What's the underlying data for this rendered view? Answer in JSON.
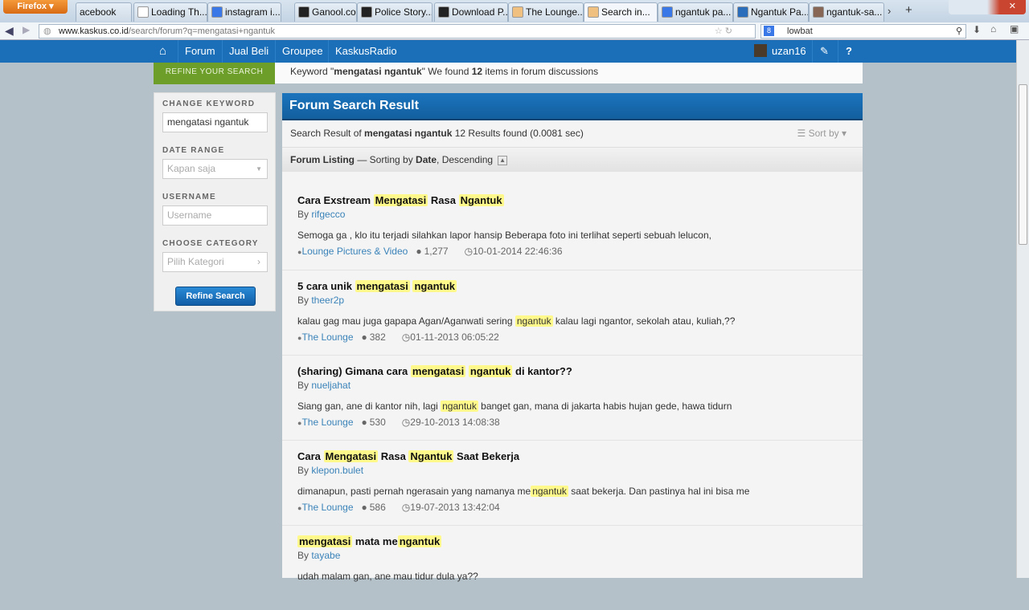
{
  "browser": {
    "menu": "Firefox",
    "tabs": [
      {
        "label": "acebook",
        "color": "#ffffff"
      },
      {
        "label": "Loading Th...",
        "color": "#ffffff"
      },
      {
        "label": "instagram i...",
        "color": "#3b78e7"
      },
      {
        "label": "Ganool.co...",
        "color": "#222222"
      },
      {
        "label": "Police Story...",
        "color": "#222222"
      },
      {
        "label": "Download P...",
        "color": "#222222"
      },
      {
        "label": "The Lounge...",
        "color": "#f0c080"
      },
      {
        "label": "Search in...",
        "color": "#f0c080"
      },
      {
        "label": "ngantuk pa...",
        "color": "#3b78e7"
      },
      {
        "label": "Ngantuk Pa...",
        "color": "#2a6ebb"
      },
      {
        "label": "ngantuk-sa...",
        "color": "#886655"
      }
    ],
    "url_host": "www.kaskus.co.id",
    "url_path": "/search/forum?q=mengatasi+ngantuk",
    "search_value": "lowbat"
  },
  "nav": {
    "items": [
      "Forum",
      "Jual Beli",
      "Groupee",
      "KaskusRadio"
    ],
    "username": "uzan16"
  },
  "refine": {
    "tab": "REFINE YOUR SEARCH",
    "kw_pre": "Keyword \"",
    "kw": "mengatasi ngantuk",
    "kw_mid": "\" We found ",
    "count": "12",
    "kw_post": " items in forum discussions"
  },
  "sidebar": {
    "change_keyword": "CHANGE KEYWORD",
    "keyword_value": "mengatasi ngantuk",
    "date_range": "DATE RANGE",
    "date_value": "Kapan saja",
    "username": "USERNAME",
    "username_placeholder": "Username",
    "category": "CHOOSE CATEGORY",
    "category_value": "Pilih Kategori",
    "button": "Refine Search"
  },
  "main": {
    "title": "Forum Search Result",
    "sr_pre": "Search Result of ",
    "sr_kw": "mengatasi ngantuk",
    "sr_post": " 12 Results found (0.0081 sec)",
    "sort": "Sort by",
    "listing": "Forum Listing",
    "listing_mid": " — Sorting by ",
    "listing_key": "Date",
    "listing_post": ", Descending"
  },
  "results": [
    {
      "title": [
        [
          "Cara Exstream ",
          0
        ],
        [
          "Mengatasi",
          1
        ],
        [
          " Rasa ",
          0
        ],
        [
          "Ngantuk",
          1
        ]
      ],
      "by": "rifgecco",
      "snippet": [
        [
          "Semoga ga , klo itu terjadi silahkan lapor hansip Beberapa foto ini terlihat seperti sebuah lelucon,",
          0
        ]
      ],
      "category": "Lounge Pictures & Video",
      "replies": "1,277",
      "date": "10-01-2014 22:46:36"
    },
    {
      "title": [
        [
          "5 cara unik ",
          0
        ],
        [
          "mengatasi",
          1
        ],
        [
          " ",
          0
        ],
        [
          "ngantuk",
          1
        ]
      ],
      "by": "theer2p",
      "snippet": [
        [
          "kalau gag mau juga gapapa Agan/Aganwati sering ",
          0
        ],
        [
          "ngantuk",
          1
        ],
        [
          " kalau lagi ngantor, sekolah atau, kuliah,??",
          0
        ]
      ],
      "category": "The Lounge",
      "replies": "382",
      "date": "01-11-2013 06:05:22"
    },
    {
      "title": [
        [
          "(sharing) Gimana cara ",
          0
        ],
        [
          "mengatasi",
          1
        ],
        [
          " ",
          0
        ],
        [
          "ngantuk",
          1
        ],
        [
          " di kantor??",
          0
        ]
      ],
      "by": "nueljahat",
      "snippet": [
        [
          "Siang gan, ane di kantor nih, lagi ",
          0
        ],
        [
          "ngantuk",
          1
        ],
        [
          " banget gan, mana di jakarta habis hujan gede, hawa tidurn",
          0
        ]
      ],
      "category": "The Lounge",
      "replies": "530",
      "date": "29-10-2013 14:08:38"
    },
    {
      "title": [
        [
          "Cara ",
          0
        ],
        [
          "Mengatasi",
          1
        ],
        [
          " Rasa ",
          0
        ],
        [
          "Ngantuk",
          1
        ],
        [
          " Saat Bekerja",
          0
        ]
      ],
      "by": "klepon.bulet",
      "snippet": [
        [
          "dimanapun, pasti pernah ngerasain yang namanya me",
          0
        ],
        [
          "ngantuk",
          1
        ],
        [
          " saat bekerja. Dan pastinya hal ini bisa me",
          0
        ]
      ],
      "category": "The Lounge",
      "replies": "586",
      "date": "19-07-2013 13:42:04"
    },
    {
      "title": [
        [
          "mengatasi",
          1
        ],
        [
          " mata me",
          0
        ],
        [
          "ngantuk",
          1
        ]
      ],
      "by": "tayabe",
      "snippet": [
        [
          "udah malam gan, ane mau tidur dula ya??",
          0
        ]
      ],
      "category": "",
      "replies": "",
      "date": ""
    }
  ],
  "by_label": "By "
}
